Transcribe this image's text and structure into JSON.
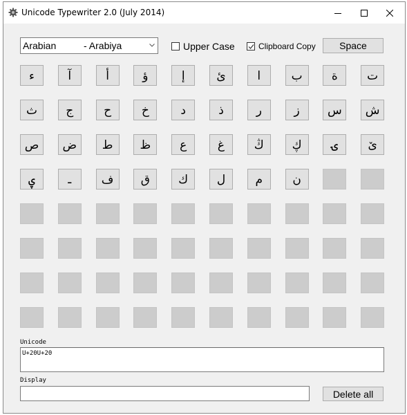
{
  "window": {
    "title": "Unicode Typewriter 2.0 (July 2014)",
    "icon": "gear-icon",
    "controls": [
      "minimize-icon",
      "maximize-icon",
      "close-icon"
    ]
  },
  "toolbar": {
    "language_select": {
      "value_name": "Arabian",
      "value_native": "- Arabiya"
    },
    "upper_case": {
      "label": "Upper Case",
      "checked": false
    },
    "clipboard_copy": {
      "label": "Clipboard Copy",
      "checked": true
    },
    "space_label": "Space"
  },
  "keys": [
    "ء",
    "آ",
    "أ",
    "ؤ",
    "إ",
    "ئ",
    "ا",
    "ب",
    "ة",
    "ت",
    "ث",
    "ج",
    "ح",
    "خ",
    "د",
    "ذ",
    "ر",
    "ز",
    "س",
    "ش",
    "ص",
    "ض",
    "ط",
    "ظ",
    "ع",
    "غ",
    "ڭ",
    "ڮ",
    "ۍ",
    "ێ",
    "ۑ",
    "ـ",
    "ف",
    "ق",
    "ك",
    "ل",
    "م",
    "ن",
    "",
    "",
    "",
    "",
    "",
    "",
    "",
    "",
    "",
    "",
    "",
    "",
    "",
    "",
    "",
    "",
    "",
    "",
    "",
    "",
    "",
    "",
    "",
    "",
    "",
    "",
    "",
    "",
    "",
    "",
    "",
    "",
    "",
    "",
    "",
    "",
    "",
    "",
    "",
    "",
    "",
    ""
  ],
  "unicode": {
    "label": "Unicode",
    "value": "U+20U+20"
  },
  "display": {
    "label": "Display",
    "value": ""
  },
  "delete_all_label": "Delete all"
}
